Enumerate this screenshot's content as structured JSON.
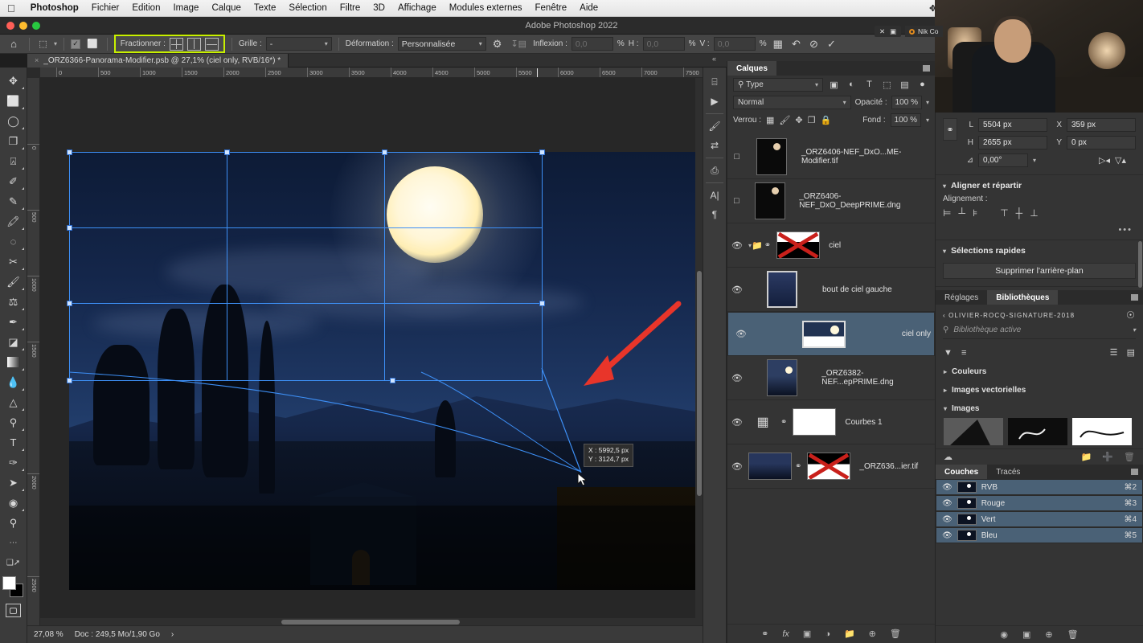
{
  "menubar": {
    "apple_icon": "apple-icon",
    "items": [
      {
        "label": "Photoshop",
        "bold": true
      },
      {
        "label": "Fichier"
      },
      {
        "label": "Edition"
      },
      {
        "label": "Image"
      },
      {
        "label": "Calque"
      },
      {
        "label": "Texte"
      },
      {
        "label": "Sélection"
      },
      {
        "label": "Filtre"
      },
      {
        "label": "3D"
      },
      {
        "label": "Affichage"
      },
      {
        "label": "Modules externes"
      },
      {
        "label": "Fenêtre"
      },
      {
        "label": "Aide"
      }
    ],
    "status_icons": [
      {
        "name": "dropbox-icon",
        "glyph": "✥"
      },
      {
        "name": "creative-cloud-icon",
        "glyph": "◎"
      },
      {
        "name": "screen-record-icon",
        "glyph": "▣"
      },
      {
        "name": "display-icon",
        "glyph": "▭"
      },
      {
        "name": "clipboard-icon",
        "glyph": "▤"
      },
      {
        "name": "clock-icon",
        "glyph": "◷"
      },
      {
        "name": "binoculars-icon",
        "glyph": "♎"
      },
      {
        "name": "layout-icon",
        "glyph": "▥"
      },
      {
        "name": "airplay-icon",
        "glyph": "□"
      },
      {
        "name": "volume-icon",
        "glyph": "◀))"
      },
      {
        "name": "wifi-icon",
        "glyph": "◠"
      },
      {
        "name": "keyboard-flag-icon",
        "glyph": "flag-fr"
      }
    ]
  },
  "window": {
    "title": "Adobe Photoshop 2022"
  },
  "options_bar": {
    "home_icon": "home-icon",
    "preset_icon": "tool-preset-icon",
    "checkbox_checked": "✓",
    "split_label": "Fractionner :",
    "split_buttons": [
      {
        "name": "split-both-icon"
      },
      {
        "name": "split-vertical-icon"
      },
      {
        "name": "split-horizontal-icon"
      }
    ],
    "grid_label": "Grille :",
    "grid_value": "-",
    "warp_label": "Déformation :",
    "warp_value": "Personnalisée",
    "gear_icon": "settings-gear-icon",
    "warp_split_icon": "warp-split-icon",
    "bend_label": "Inflexion :",
    "bend_value": "0,0",
    "pct1": "%",
    "h_label": "H :",
    "h_value": "0,0",
    "pct2": "%",
    "v_label": "V :",
    "v_value": "0,0",
    "pct3": "%",
    "mesh_icon": "warp-mesh-icon",
    "reset_icon": "reset-icon",
    "cancel_icon": "cancel-icon",
    "commit_icon": "commit-check-icon"
  },
  "document_tab": {
    "close_icon": "×",
    "title": "_ORZ6366-Panorama-Modifier.psb @ 27,1% (ciel only, RVB/16*) *"
  },
  "toolbar": {
    "tools_top": [
      {
        "name": "move-tool",
        "glyph": "✥"
      },
      {
        "name": "marquee-tool",
        "glyph": "▭"
      },
      {
        "name": "lasso-tool",
        "glyph": "◯"
      },
      {
        "name": "object-selection-tool",
        "glyph": "❐"
      },
      {
        "name": "crop-tool",
        "glyph": "⌗"
      },
      {
        "name": "eyedropper-tool",
        "glyph": "✐"
      },
      {
        "name": "healing-brush-tool",
        "glyph": "❏"
      },
      {
        "name": "brush-tool-alt",
        "glyph": "✎"
      },
      {
        "name": "patch-tool",
        "glyph": "◌"
      },
      {
        "name": "clone-source-tool",
        "glyph": "✄"
      },
      {
        "name": "paint-brush-tool",
        "glyph": "🖌"
      },
      {
        "name": "clone-stamp-tool",
        "glyph": "♟"
      },
      {
        "name": "history-brush-tool",
        "glyph": "✒"
      },
      {
        "name": "eraser-tool",
        "glyph": "◣"
      },
      {
        "name": "gradient-tool",
        "glyph": "▬"
      },
      {
        "name": "blur-tool",
        "glyph": "💧"
      },
      {
        "name": "dodge-tool",
        "glyph": "▲"
      },
      {
        "name": "sponge-tool",
        "glyph": "⚲"
      },
      {
        "name": "type-tool",
        "glyph": "T"
      },
      {
        "name": "pen-tool",
        "glyph": "✑"
      },
      {
        "name": "path-selection-tool",
        "glyph": "➤"
      },
      {
        "name": "shape-tool",
        "glyph": "◉"
      },
      {
        "name": "zoom-tool",
        "glyph": "⚲"
      },
      {
        "name": "more-tools",
        "glyph": "•••"
      },
      {
        "name": "edit-toolbar-icon",
        "glyph": "⧉"
      }
    ],
    "foreground_color": "#ffffff",
    "background_color": "#000000",
    "quick_mask_icon": "quick-mask-icon"
  },
  "rulers": {
    "h_ticks": [
      "0",
      "500",
      "1000",
      "1500",
      "2000",
      "2500",
      "3000",
      "3500",
      "4000",
      "4500",
      "5000",
      "5500",
      "6000",
      "6500",
      "7000",
      "7500"
    ],
    "v_ticks": [
      "0",
      "500",
      "1000",
      "1500",
      "2000",
      "2500"
    ],
    "marker_position_label": "5750"
  },
  "canvas": {
    "transform_tooltip": {
      "x_line": "X : 5992,5 px",
      "y_line": "Y : 3124,7 px"
    },
    "annotation_arrow": "red-arrow-annotation",
    "selection_color": "#3d8ff5"
  },
  "status_bar": {
    "zoom": "27,08 %",
    "doc_info": "Doc : 249,5 Mo/1,90 Go",
    "expand_icon": "›"
  },
  "icon_rail": [
    {
      "name": "history-icon",
      "glyph": "⌸"
    },
    {
      "name": "actions-play-icon",
      "glyph": "▶"
    },
    {
      "name": "brush-settings-icon",
      "glyph": "🖌"
    },
    {
      "name": "adjustments-sliders-icon",
      "glyph": "⇄"
    },
    {
      "name": "clone-source-panel-icon",
      "glyph": "⎙"
    },
    {
      "name": "character-panel-icon",
      "glyph": "A|"
    },
    {
      "name": "paragraph-panel-icon",
      "glyph": "¶"
    }
  ],
  "layers_panel": {
    "tab_label": "Calques",
    "panel_menu_icon": "panel-menu-icon",
    "filter": {
      "icon": "search-icon",
      "value": "Type",
      "caret": "⌄"
    },
    "filter_type_icons": [
      {
        "name": "filter-pixel-icon",
        "glyph": "▣"
      },
      {
        "name": "filter-adjustment-icon",
        "glyph": "◐"
      },
      {
        "name": "filter-type-icon",
        "glyph": "T"
      },
      {
        "name": "filter-shape-icon",
        "glyph": "⬚"
      },
      {
        "name": "filter-smart-object-icon",
        "glyph": "▤"
      }
    ],
    "filter_toggle_icon": "filter-power-toggle",
    "blend_mode": "Normal",
    "opacity_label": "Opacité :",
    "opacity_value": "100 %",
    "lock_label": "Verrou :",
    "lock_icons": [
      {
        "name": "lock-transparency-icon",
        "glyph": "▦"
      },
      {
        "name": "lock-image-icon",
        "glyph": "🖌"
      },
      {
        "name": "lock-position-icon",
        "glyph": "✥"
      },
      {
        "name": "lock-nesting-icon",
        "glyph": "❐"
      },
      {
        "name": "lock-all-icon",
        "glyph": "🔒"
      }
    ],
    "fill_label": "Fond :",
    "fill_value": "100 %",
    "layers": [
      {
        "name": "_ORZ6406-NEF_DxO...ME-Modifier.tif",
        "visible": false,
        "selected": false,
        "thumb": "night-moon",
        "has_group": false,
        "has_link": false,
        "has_mask": false,
        "mask_crossed": false
      },
      {
        "name": "_ORZ6406-NEF_DxO_DeepPRIME.dng",
        "visible": false,
        "selected": false,
        "thumb": "night-moon",
        "has_group": false,
        "has_link": false,
        "has_mask": false,
        "mask_crossed": false
      },
      {
        "name": "ciel",
        "visible": true,
        "selected": false,
        "thumb": "mask-crossed",
        "has_group": true,
        "has_link": true,
        "has_mask": true,
        "mask_crossed": true
      },
      {
        "name": "bout de ciel gauche",
        "visible": true,
        "selected": false,
        "thumb": "blue-gradient",
        "has_group": false,
        "has_link": false,
        "has_mask": false,
        "mask_crossed": false
      },
      {
        "name": "ciel only",
        "visible": true,
        "selected": true,
        "thumb": "sky-pano",
        "has_group": false,
        "has_link": false,
        "has_mask": false,
        "mask_crossed": false
      },
      {
        "name": "_ORZ6382-NEF...epPRIME.dng",
        "visible": true,
        "selected": false,
        "thumb": "night-scene",
        "has_group": false,
        "has_link": false,
        "has_mask": false,
        "mask_crossed": false
      },
      {
        "name": "Courbes 1",
        "visible": true,
        "selected": false,
        "thumb": "white",
        "has_group": false,
        "has_link": true,
        "has_mask": true,
        "mask_crossed": false,
        "adjustment_icon": "curves-icon"
      },
      {
        "name": "_ORZ636...ier.tif",
        "visible": true,
        "selected": false,
        "thumb": "landscape",
        "has_group": false,
        "has_link": true,
        "has_mask": true,
        "mask_crossed": true
      }
    ],
    "footer_icons": [
      {
        "name": "link-layers-icon",
        "glyph": "⚭"
      },
      {
        "name": "layer-style-fx-icon",
        "glyph": "fx"
      },
      {
        "name": "add-layer-mask-icon",
        "glyph": "▣"
      },
      {
        "name": "new-adjustment-layer-icon",
        "glyph": "◑"
      },
      {
        "name": "new-group-icon",
        "glyph": "▭"
      },
      {
        "name": "new-layer-icon",
        "glyph": "⊞"
      },
      {
        "name": "delete-layer-icon",
        "glyph": "🗑"
      }
    ]
  },
  "webcam_overlay": {
    "close_icon": "✕",
    "minimize_icon": "▣",
    "badge_label": "Nik Co",
    "badge_icon": "record-ring-icon"
  },
  "properties_panel": {
    "link_icon": "link-dimensions-icon",
    "w_label": "L",
    "w_value": "5504 px",
    "h_label": "H",
    "h_value": "2655 px",
    "x_label": "X",
    "x_value": "359 px",
    "y_label": "Y",
    "y_value": "0 px",
    "angle_icon": "angle-icon",
    "angle_value": "0,00°",
    "flip_h_icon": "flip-horizontal-icon",
    "flip_v_icon": "flip-vertical-icon",
    "align_section_title": "Aligner et répartir",
    "align_label": "Alignement :",
    "align_icons": [
      {
        "name": "align-left-icon",
        "glyph": "⊨"
      },
      {
        "name": "align-center-h-icon",
        "glyph": "╪"
      },
      {
        "name": "align-right-icon",
        "glyph": "⊧"
      },
      {
        "name": "align-top-icon",
        "glyph": "⊤"
      },
      {
        "name": "align-middle-v-icon",
        "glyph": "╫"
      },
      {
        "name": "align-bottom-icon",
        "glyph": "⊥"
      }
    ],
    "more_icon": "•••",
    "quickactions_title": "Sélections rapides",
    "remove_background_label": "Supprimer l'arrière-plan"
  },
  "libraries_panel": {
    "tabs": [
      {
        "label": "Réglages",
        "active": false
      },
      {
        "label": "Bibliothèques",
        "active": true
      }
    ],
    "panel_menu_icon": "panel-menu-icon",
    "back_icon": "‹",
    "library_name": "OLIVIER-ROCQ-SIGNATURE-2018",
    "account_icon": "account-icon",
    "search_icon": "search-icon",
    "search_placeholder": "Bibliothèque active",
    "caret_icon": "⌄",
    "filter_icon": "filter-funnel-icon",
    "sort_icon": "sort-icon",
    "view_list_icon": "view-list-icon",
    "view_grid_icon": "view-grid-icon",
    "groups": [
      {
        "label": "Couleurs",
        "expanded": false
      },
      {
        "label": "Images vectorielles",
        "expanded": false
      },
      {
        "label": "Images",
        "expanded": true
      }
    ],
    "footer": {
      "cloud_icon": "cloud-sync-icon",
      "new_group_icon": "new-group-icon",
      "add_icon": "add-content-icon",
      "delete_icon": "delete-icon"
    }
  },
  "channels_panel": {
    "tabs": [
      {
        "label": "Couches",
        "active": true
      },
      {
        "label": "Tracés",
        "active": false
      }
    ],
    "panel_menu_icon": "panel-menu-icon",
    "channels": [
      {
        "name": "RVB",
        "shortcut": "⌘2",
        "visible": true,
        "selected": true
      },
      {
        "name": "Rouge",
        "shortcut": "⌘3",
        "visible": true,
        "selected": true
      },
      {
        "name": "Vert",
        "shortcut": "⌘4",
        "visible": true,
        "selected": true
      },
      {
        "name": "Bleu",
        "shortcut": "⌘5",
        "visible": true,
        "selected": true
      }
    ],
    "footer_icons": [
      {
        "name": "load-channel-selection-icon",
        "glyph": "⊙"
      },
      {
        "name": "save-selection-as-channel-icon",
        "glyph": "▣"
      },
      {
        "name": "new-channel-icon",
        "glyph": "⊞"
      },
      {
        "name": "delete-channel-icon",
        "glyph": "🗑"
      }
    ]
  },
  "colors": {
    "accent_green": "#c8f000",
    "selection_blue": "#4a6176",
    "arrow_red": "#e8352a",
    "panel_bg": "#343434"
  }
}
